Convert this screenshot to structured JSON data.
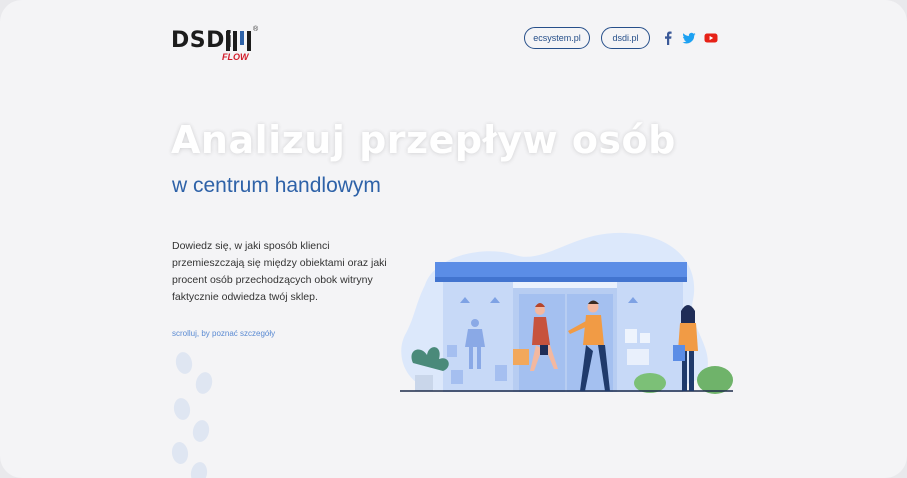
{
  "brand": {
    "logo_main": "DSDi",
    "logo_sub": "FLOW",
    "reg_mark": "®"
  },
  "nav": {
    "links": [
      {
        "label": "ecsystem.pl"
      },
      {
        "label": "dsdi.pl"
      }
    ],
    "social": [
      "facebook-icon",
      "twitter-icon",
      "youtube-icon"
    ]
  },
  "hero": {
    "title": "Analizuj przepływ osób",
    "subtitle": "w centrum handlowym",
    "description": "Dowiedz się, w jaki sposób klienci przemieszczają się między obiektami oraz jaki procent osób przechodzących obok witryny faktycznie odwiedza twój sklep.",
    "scroll_hint": "scrolluj, by poznać szczegóły"
  },
  "colors": {
    "background": "#f4f4f6",
    "accent_blue": "#2e62a8",
    "pill_border": "#264f8a",
    "brand_red": "#d21c2a",
    "facebook": "#3b5998",
    "twitter": "#1da1f2",
    "youtube": "#e62117"
  }
}
